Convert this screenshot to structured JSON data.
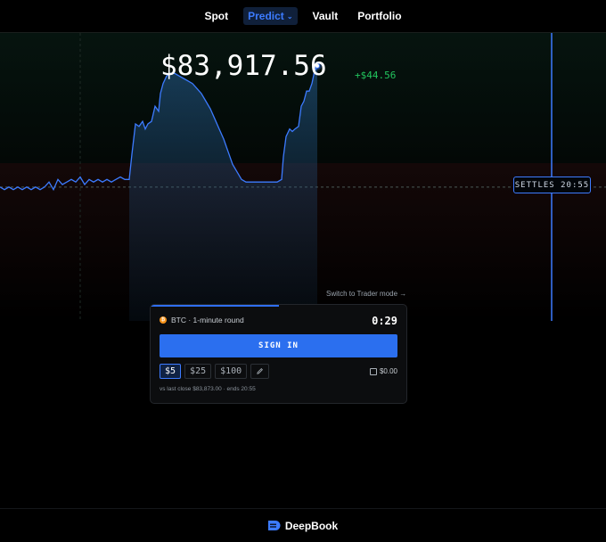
{
  "nav": {
    "items": [
      {
        "label": "Spot"
      },
      {
        "label": "Predict",
        "active": true
      },
      {
        "label": "Vault"
      },
      {
        "label": "Portfolio"
      }
    ],
    "accent": "#3c7bff"
  },
  "market": {
    "price": "$83,917.56",
    "change": "+$44.56",
    "change_color": "#22c55e",
    "settles": "SETTLES 20:55"
  },
  "chart_data": {
    "type": "line",
    "series": [
      {
        "points": [
          [
            0,
            83873
          ],
          [
            5,
            83872
          ],
          [
            10,
            83873
          ],
          [
            15,
            83872
          ],
          [
            20,
            83873
          ],
          [
            25,
            83872
          ],
          [
            30,
            83873
          ],
          [
            35,
            83872
          ],
          [
            40,
            83873
          ],
          [
            45,
            83872
          ],
          [
            50,
            83873
          ],
          [
            55,
            83875
          ],
          [
            60,
            83872
          ],
          [
            65,
            83876
          ],
          [
            70,
            83874
          ],
          [
            75,
            83875
          ],
          [
            80,
            83876
          ],
          [
            85,
            83875
          ],
          [
            90,
            83877
          ],
          [
            95,
            83874
          ],
          [
            100,
            83876
          ],
          [
            105,
            83875
          ],
          [
            110,
            83876
          ],
          [
            115,
            83875
          ],
          [
            120,
            83876
          ],
          [
            125,
            83875
          ],
          [
            130,
            83876
          ],
          [
            135,
            83877
          ],
          [
            140,
            83876
          ],
          [
            145,
            83876
          ],
          [
            148,
            83886
          ],
          [
            152,
            83898
          ],
          [
            156,
            83897
          ],
          [
            160,
            83899
          ],
          [
            163,
            83896
          ],
          [
            166,
            83898
          ],
          [
            170,
            83899
          ],
          [
            174,
            83905
          ],
          [
            178,
            83903
          ],
          [
            180,
            83910
          ],
          [
            183,
            83914
          ],
          [
            187,
            83917
          ],
          [
            191,
            83918
          ],
          [
            196,
            83918
          ],
          [
            201,
            83917
          ],
          [
            206,
            83916
          ],
          [
            211,
            83915
          ],
          [
            216,
            83914
          ],
          [
            221,
            83912
          ],
          [
            226,
            83910
          ],
          [
            231,
            83907
          ],
          [
            236,
            83904
          ],
          [
            241,
            83900
          ],
          [
            246,
            83896
          ],
          [
            251,
            83892
          ],
          [
            256,
            83887
          ],
          [
            261,
            83882
          ],
          [
            266,
            83879
          ],
          [
            271,
            83876
          ],
          [
            276,
            83875
          ],
          [
            281,
            83875
          ],
          [
            286,
            83875
          ],
          [
            291,
            83875
          ],
          [
            296,
            83875
          ],
          [
            301,
            83875
          ],
          [
            306,
            83875
          ],
          [
            311,
            83875
          ],
          [
            316,
            83876
          ],
          [
            318,
            83885
          ],
          [
            321,
            83893
          ],
          [
            325,
            83896
          ],
          [
            328,
            83895
          ],
          [
            331,
            83896
          ],
          [
            335,
            83897
          ],
          [
            338,
            83905
          ],
          [
            341,
            83907
          ],
          [
            344,
            83911
          ],
          [
            347,
            83911
          ],
          [
            350,
            83914
          ],
          [
            353,
            83919
          ],
          [
            356,
            83921
          ]
        ]
      }
    ],
    "baseline": 83873,
    "ylim": [
      83820,
      83934
    ],
    "xlim": [
      0,
      680
    ]
  },
  "switch_mode": {
    "label": "Switch to Trader mode →"
  },
  "round_card": {
    "round_label": "BTC · 1-minute round",
    "timer": "0:29",
    "progress": 0.5,
    "signin_label": "SIGN IN",
    "amounts": [
      "$5",
      "$25",
      "$100"
    ],
    "selected_amount": "$5",
    "balance": "$0.00",
    "note": "vs last close $83,873.00 · ends 20:55"
  },
  "footer": {
    "brand": "DeepBook"
  }
}
